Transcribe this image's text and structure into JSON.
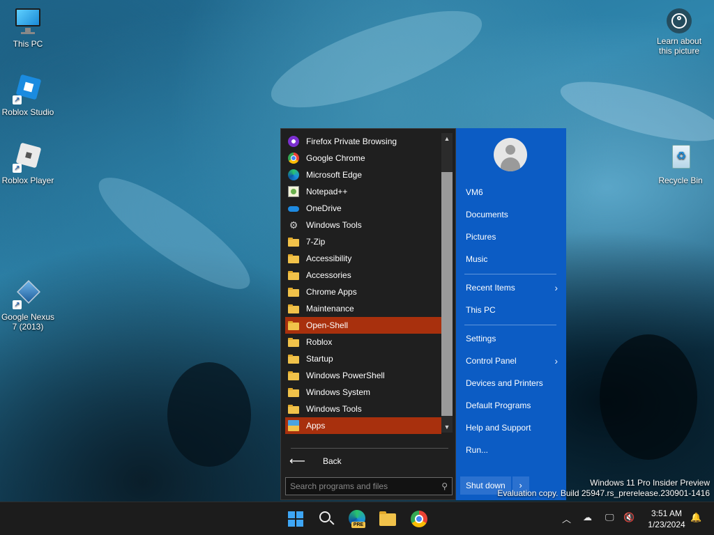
{
  "desktop": {
    "icons": [
      {
        "label": "This PC"
      },
      {
        "label": "Roblox Studio"
      },
      {
        "label": "Roblox Player"
      },
      {
        "label": "Google Nexus 7 (2013)"
      },
      {
        "label": "Recycle Bin"
      }
    ],
    "learn_label": "Learn about this picture",
    "watermark": {
      "line1": "Windows 11 Pro Insider Preview",
      "line2": "Evaluation copy. Build 25947.rs_prerelease.230901-1416"
    }
  },
  "start_menu": {
    "programs": [
      {
        "label": "Firefox Private Browsing",
        "icon": "firefox-private-icon"
      },
      {
        "label": "Google Chrome",
        "icon": "chrome-icon"
      },
      {
        "label": "Microsoft Edge",
        "icon": "edge-icon"
      },
      {
        "label": "Notepad++",
        "icon": "notepadpp-icon"
      },
      {
        "label": "OneDrive",
        "icon": "onedrive-icon"
      },
      {
        "label": "Windows Tools",
        "icon": "windows-tools-icon"
      },
      {
        "label": "7-Zip",
        "icon": "folder-icon"
      },
      {
        "label": "Accessibility",
        "icon": "folder-icon"
      },
      {
        "label": "Accessories",
        "icon": "folder-icon"
      },
      {
        "label": "Chrome Apps",
        "icon": "folder-icon"
      },
      {
        "label": "Maintenance",
        "icon": "folder-icon"
      },
      {
        "label": "Open-Shell",
        "icon": "folder-icon",
        "selected": true
      },
      {
        "label": "Roblox",
        "icon": "folder-icon"
      },
      {
        "label": "Startup",
        "icon": "folder-icon"
      },
      {
        "label": "Windows PowerShell",
        "icon": "folder-icon"
      },
      {
        "label": "Windows System",
        "icon": "folder-icon"
      },
      {
        "label": "Windows Tools",
        "icon": "folder-icon"
      },
      {
        "label": "Apps",
        "icon": "apps-icon",
        "selected": true
      }
    ],
    "back_label": "Back",
    "search_placeholder": "Search programs and files",
    "right_items": [
      {
        "label": "VM6"
      },
      {
        "label": "Documents"
      },
      {
        "label": "Pictures"
      },
      {
        "label": "Music"
      },
      {
        "label": "Recent Items",
        "submenu": true
      },
      {
        "label": "This PC"
      },
      {
        "label": "Settings"
      },
      {
        "label": "Control Panel",
        "submenu": true
      },
      {
        "label": "Devices and Printers"
      },
      {
        "label": "Default Programs"
      },
      {
        "label": "Help and Support"
      },
      {
        "label": "Run..."
      }
    ],
    "shutdown_label": "Shut down"
  },
  "taskbar": {
    "time": "3:51 AM",
    "date": "1/23/2024",
    "edge_badge": "PRE"
  },
  "colors": {
    "selection": "#a8300d",
    "right_panel": "#0c5cc4",
    "left_panel": "#1f1f1f"
  }
}
